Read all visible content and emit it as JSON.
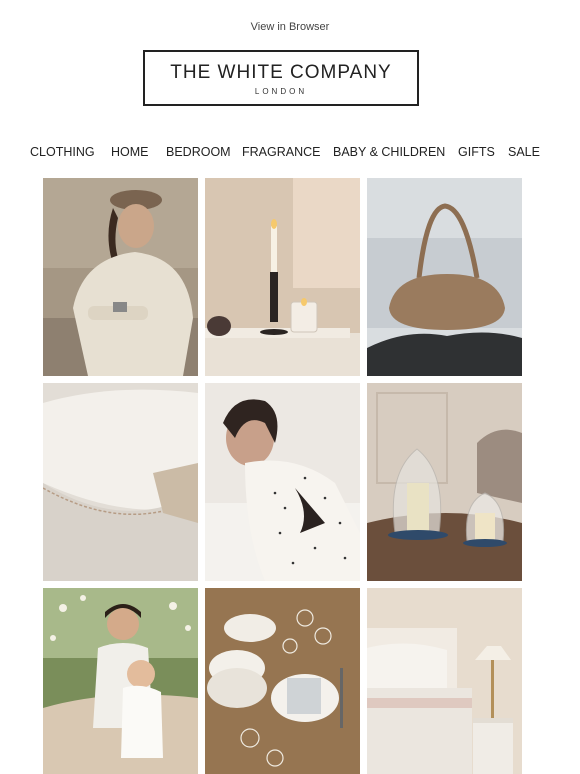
{
  "header": {
    "view_in_browser": "View in Browser"
  },
  "logo": {
    "name": "THE WHITE COMPANY",
    "location": "LONDON"
  },
  "nav": {
    "items": [
      {
        "label": "CLOTHING"
      },
      {
        "label": "HOME"
      },
      {
        "label": "BEDROOM"
      },
      {
        "label": "FRAGRANCE"
      },
      {
        "label": "BABY & CHILDREN"
      },
      {
        "label": "GIFTS"
      },
      {
        "label": "SALE"
      }
    ]
  },
  "colors": {
    "text": "#222222",
    "background": "#ffffff"
  }
}
